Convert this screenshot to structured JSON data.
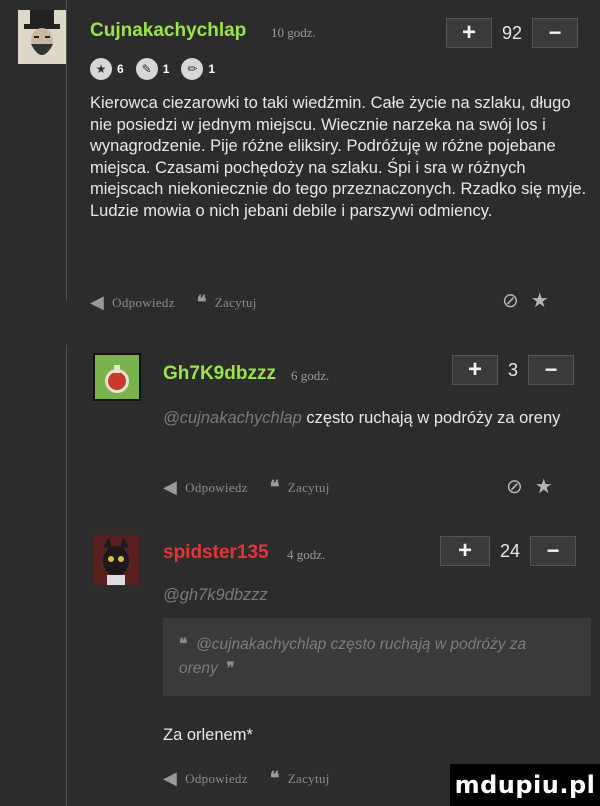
{
  "comments": [
    {
      "username": "Cujnakachychlap",
      "time": "10 godz.",
      "score": "92",
      "badges": [
        "6",
        "1",
        "1"
      ],
      "text": "Kierowca ciezarowki to taki wiedźmin. Całe życie na szlaku, długo nie posiedzi w jednym miejscu. Wiecznie narzeka na swój los i wynagrodzenie. Pije różne eliksiry. Podróżuję w różne pojebane miejsca. Czasami pochędoży na szlaku. Śpi i sra w różnych miejscach niekoniecznie do tego przeznaczonych. Rzadko się myje. Ludzie mowia o nich jebani debile i parszywi odmiency."
    },
    {
      "username": "Gh7K9dbzzz",
      "time": "6 godz.",
      "score": "3",
      "mention": "@cujnakachychlap",
      "text": "często ruchają w podróży za oreny"
    },
    {
      "username": "spidster135",
      "time": "4 godz.",
      "score": "24",
      "mention": "@gh7k9dbzzz",
      "quote": "@cujnakachychlap często ruchają w podróży za oreny",
      "text": "Za orlenem*"
    }
  ],
  "actions": {
    "reply": "Odpowiedz",
    "quote": "Zacytuj"
  },
  "vote": {
    "plus": "+",
    "minus": "−"
  },
  "icons": {
    "reply": "reply-arrow-icon",
    "quote": "quote-icon",
    "flag": "flag-icon",
    "favorite": "star-icon"
  },
  "colors": {
    "background": "#2c2c2c",
    "username": "#9be34a",
    "username_op": "#4fb8e8",
    "username_red": "#e53434"
  },
  "watermark": "mdupiu.pl"
}
